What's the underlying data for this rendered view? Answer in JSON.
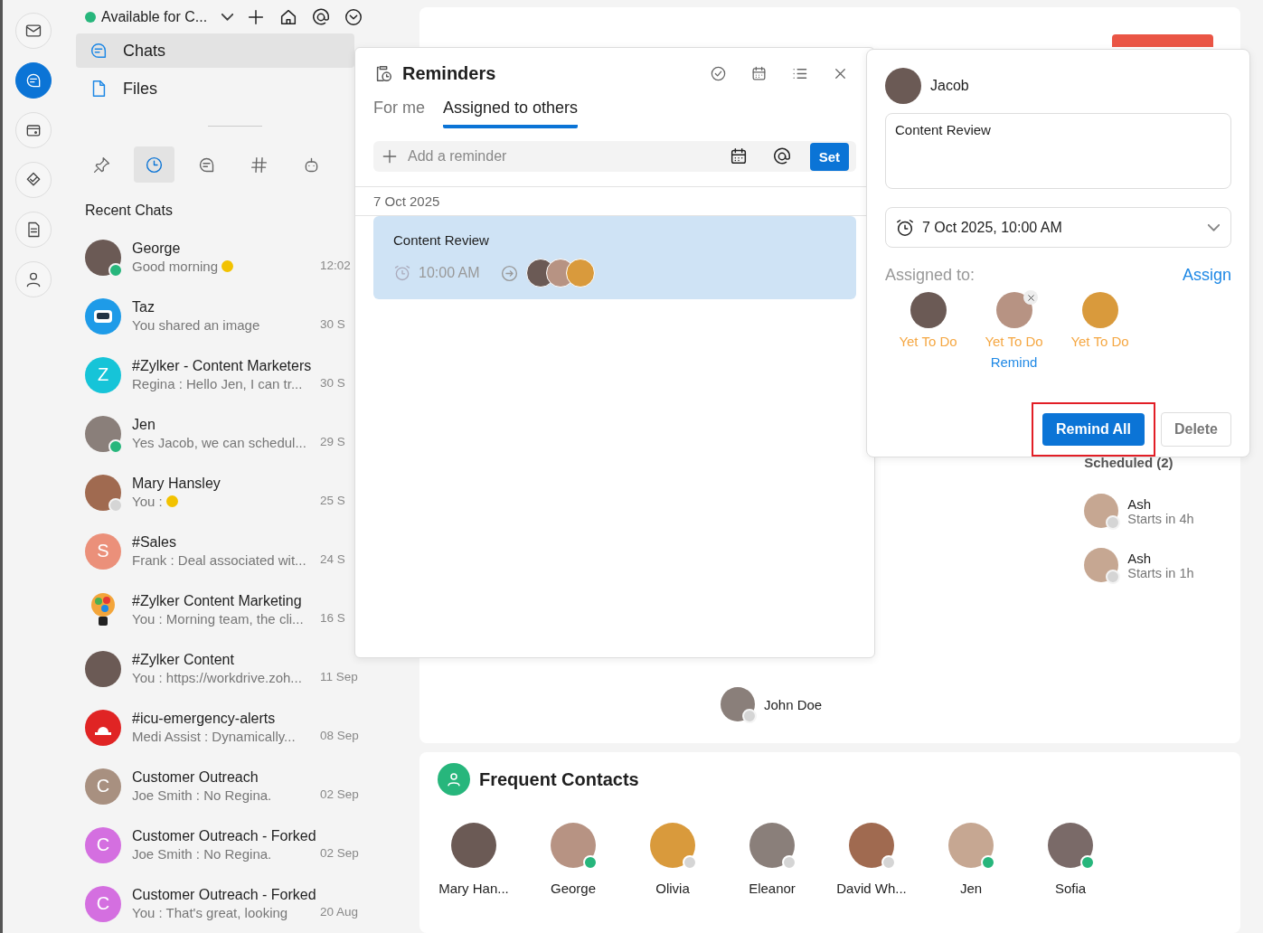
{
  "rail": [
    {
      "selected": false
    },
    {
      "selected": true
    },
    {
      "selected": false
    },
    {
      "selected": false
    },
    {
      "selected": false
    },
    {
      "selected": false
    }
  ],
  "sidebar": {
    "status": {
      "label": "Available for C...",
      "color": "#27b67c"
    },
    "nav": [
      {
        "label": "Chats",
        "selected": true
      },
      {
        "label": "Files",
        "selected": false
      }
    ],
    "filters": [
      {
        "selected": false
      },
      {
        "selected": true
      },
      {
        "selected": false
      },
      {
        "selected": false
      },
      {
        "selected": false
      }
    ],
    "section_title": "Recent Chats",
    "chats": [
      {
        "name": "George",
        "preview": "Good morning",
        "emoji": true,
        "time": "12:02",
        "kind": "photo",
        "status": {
          "color": "#27b67c"
        }
      },
      {
        "name": "Taz",
        "preview": "You shared an image",
        "time": "30 S",
        "kind": "bot"
      },
      {
        "name": "#Zylker - Content Marketers",
        "preview": "Regina : Hello Jen, I can tr...",
        "time": "30 S",
        "kind": "letter",
        "letter": "Z",
        "color": "#16c4d8"
      },
      {
        "name": "Jen",
        "preview": "Yes Jacob, we can schedul...",
        "time": "29 S",
        "kind": "photo",
        "status": {
          "color": "#27b67c"
        }
      },
      {
        "name": "Mary Hansley",
        "preview": "You :",
        "emoji": true,
        "time": "25 S",
        "kind": "photo",
        "status": {
          "color": "#d5d5d5"
        }
      },
      {
        "name": "#Sales",
        "preview": "Frank : Deal associated wit...",
        "time": "24 S",
        "kind": "letter",
        "letter": "S",
        "color": "#eb907a"
      },
      {
        "name": "#Zylker Content Marketing",
        "preview": "You : Morning team, the cli...",
        "time": "16 S",
        "kind": "bulb"
      },
      {
        "name": "#Zylker Content",
        "preview": "You : https://workdrive.zoh...",
        "time": "11 Sep",
        "kind": "photo"
      },
      {
        "name": "#icu-emergency-alerts",
        "preview": "Medi Assist : Dynamically...",
        "time": "08 Sep",
        "kind": "alert"
      },
      {
        "name": "Customer Outreach",
        "preview": "Joe Smith : No Regina.",
        "time": "02 Sep",
        "kind": "letter",
        "letter": "C",
        "color": "#a89080"
      },
      {
        "name": "Customer Outreach - Forked",
        "preview": "Joe Smith : No Regina.",
        "time": "02 Sep",
        "kind": "letter",
        "letter": "C",
        "color": "#d46fe0"
      },
      {
        "name": "Customer Outreach - Forked",
        "preview": "You : That's great, looking",
        "time": "20 Aug",
        "kind": "letter",
        "letter": "C",
        "color": "#d46fe0"
      }
    ]
  },
  "schedule": {
    "title": "Scheduled (2)",
    "items": [
      {
        "name": "Ash",
        "detail": "Starts in 4h",
        "status": {
          "color": "#d5d5d5"
        }
      },
      {
        "name": "Ash",
        "detail": "Starts in 1h",
        "status": {
          "color": "#d5d5d5"
        }
      }
    ],
    "people": [
      {
        "name": "John Doe",
        "status": {
          "color": "#d5d5d5"
        }
      }
    ]
  },
  "frequent": {
    "title": "Frequent Contacts",
    "contacts": [
      {
        "name": "Mary Han..."
      },
      {
        "name": "George",
        "status": {
          "color": "#27b67c"
        }
      },
      {
        "name": "Olivia",
        "status": {
          "color": "#d5d5d5"
        }
      },
      {
        "name": "Eleanor",
        "status": {
          "color": "#d5d5d5"
        }
      },
      {
        "name": "David Wh...",
        "status": {
          "color": "#d5d5d5"
        }
      },
      {
        "name": "Jen",
        "status": {
          "color": "#27b67c"
        }
      },
      {
        "name": "Sofia",
        "status": {
          "color": "#27b67c"
        }
      }
    ]
  },
  "reminders": {
    "title": "Reminders",
    "tabs": [
      {
        "label": "For me",
        "selected": false
      },
      {
        "label": "Assigned to others",
        "selected": true
      }
    ],
    "add": {
      "placeholder": "Add a reminder",
      "button": "Set"
    },
    "groups": [
      {
        "date": "7 Oct 2025",
        "items": [
          {
            "title": "Content Review",
            "time": "10:00 AM",
            "selected": true
          }
        ]
      }
    ]
  },
  "detail": {
    "owner": "Jacob",
    "text": "Content Review",
    "datetime": "7 Oct 2025, 10:00 AM",
    "assigned_label": "Assigned to:",
    "assign_link": "Assign",
    "assignees": [
      {
        "status": "Yet To Do",
        "removable": false
      },
      {
        "status": "Yet To Do",
        "removable": true,
        "action": "Remind"
      },
      {
        "status": "Yet To Do",
        "removable": false
      }
    ],
    "primary": "Remind All",
    "secondary": "Delete",
    "highlight": true
  }
}
